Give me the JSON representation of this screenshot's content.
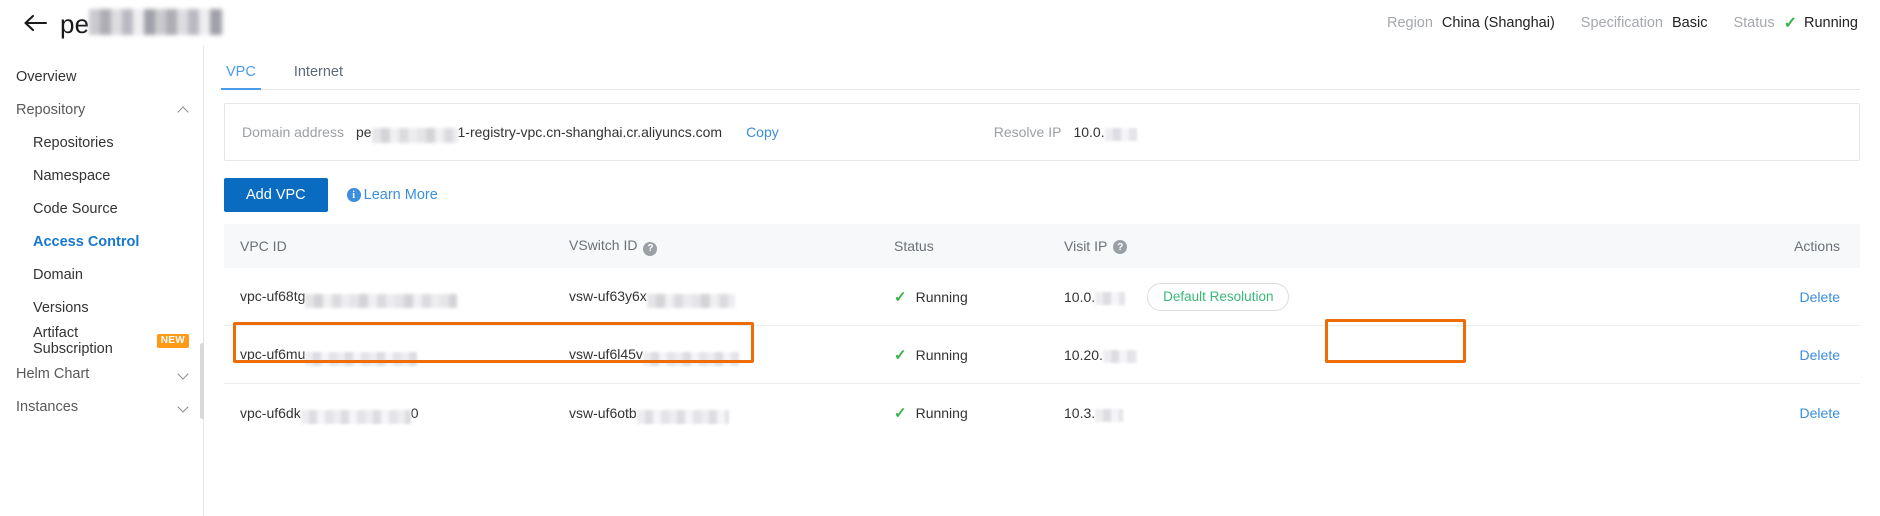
{
  "header": {
    "back_icon": "back-arrow-icon",
    "title_prefix": "pe",
    "meta": [
      {
        "label": "Region",
        "value": "China (Shanghai)"
      },
      {
        "label": "Specification",
        "value": "Basic"
      },
      {
        "label": "Status",
        "value": "Running",
        "icon": "check-icon"
      }
    ]
  },
  "sidebar": {
    "items": [
      {
        "label": "Overview",
        "type": "item"
      },
      {
        "label": "Repository",
        "type": "group",
        "chevron": "chevron-up-icon"
      },
      {
        "label": "Repositories",
        "type": "sub"
      },
      {
        "label": "Namespace",
        "type": "sub"
      },
      {
        "label": "Code Source",
        "type": "sub"
      },
      {
        "label": "Access Control",
        "type": "sub",
        "active": true
      },
      {
        "label": "Domain",
        "type": "sub"
      },
      {
        "label": "Versions",
        "type": "sub"
      },
      {
        "label": "Artifact Subscription",
        "type": "sub",
        "badge": "NEW"
      },
      {
        "label": "Helm Chart",
        "type": "group",
        "chevron": "chevron-down-icon"
      },
      {
        "label": "Instances",
        "type": "group",
        "chevron": "chevron-down-icon"
      }
    ]
  },
  "tabs": [
    {
      "label": "VPC",
      "active": true
    },
    {
      "label": "Internet",
      "active": false
    }
  ],
  "panel": {
    "domain_label": "Domain address",
    "domain_prefix": "pe",
    "domain_suffix": "1-registry-vpc.cn-shanghai.cr.aliyuncs.com",
    "copy_label": "Copy",
    "resolve_label": "Resolve IP",
    "resolve_value": "10.0."
  },
  "toolbar": {
    "add_vpc_label": "Add VPC",
    "learn_more_label": "Learn More",
    "info_icon": "info-icon"
  },
  "table": {
    "columns": [
      {
        "label": "VPC ID"
      },
      {
        "label": "VSwitch ID",
        "help": true
      },
      {
        "label": "Status"
      },
      {
        "label": "Visit IP",
        "help": true
      },
      {
        "label": "Actions"
      }
    ],
    "rows": [
      {
        "vpc_id": "vpc-uf68tg",
        "vswitch_id": "vsw-uf63y6x",
        "status": "Running",
        "visit_ip": "10.0.",
        "pill_label": "Default Resolution",
        "action_label": "Delete"
      },
      {
        "vpc_id": "vpc-uf6mu",
        "vswitch_id": "vsw-uf6l45v",
        "status": "Running",
        "visit_ip": "10.20.",
        "pill_label": "",
        "action_label": "Delete"
      },
      {
        "vpc_id": "vpc-uf6dk",
        "vpc_id_tail": "0",
        "vswitch_id": "vsw-uf6otb",
        "status": "Running",
        "visit_ip": "10.3.",
        "pill_label": "",
        "action_label": "Delete"
      }
    ]
  },
  "colors": {
    "accent_blue": "#0a6cc1",
    "link_blue": "#3b8ede",
    "tab_blue": "#4a9bea",
    "nav_active_blue": "#1677d2",
    "status_green": "#38b349",
    "pill_green": "#3bb878",
    "badge_orange": "#ff9a16",
    "annotation_orange": "#ed6c05"
  }
}
